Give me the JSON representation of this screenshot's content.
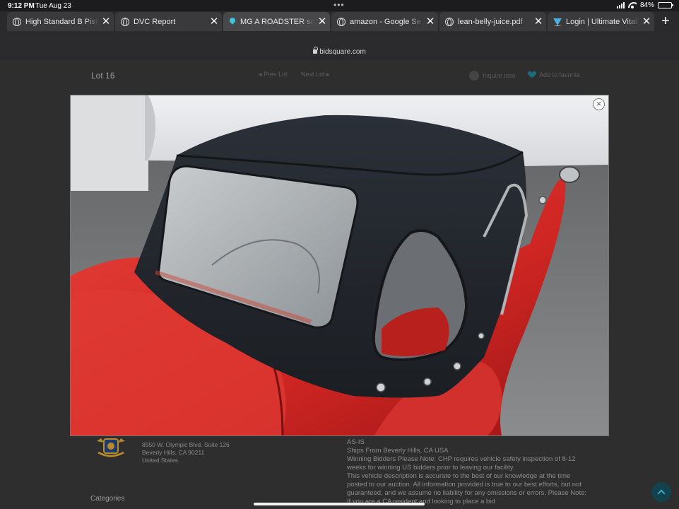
{
  "status_bar": {
    "time": "9:12 PM",
    "date": "Tue Aug 23",
    "dots": "•••",
    "battery": "84%",
    "battery_level": 0.84
  },
  "tabs": [
    {
      "title": "High Standard B Pistol",
      "icon": "globe-icon",
      "active": false
    },
    {
      "title": "DVC Report",
      "icon": "globe-icon",
      "active": false
    },
    {
      "title": "MG A ROADSTER sold",
      "icon": "pin-icon",
      "active": true
    },
    {
      "title": "amazon - Google Search",
      "icon": "globe-icon",
      "active": false
    },
    {
      "title": "lean-belly-juice.pdf",
      "icon": "globe-icon",
      "active": false
    },
    {
      "title": "Login | Ultimate Vitality",
      "icon": "bird-icon",
      "active": false
    }
  ],
  "tab_close": "✕",
  "new_tab": "+",
  "address": {
    "url": "bidsquare.com"
  },
  "page": {
    "lot": "Lot 16",
    "prev": "◂ Prev Lot",
    "next": "Next Lot ▸",
    "inquire": "Inquire now",
    "favorite": "Add to favorite",
    "seller_address": {
      "line1": "8950 W. Olympic Blvd. Suite 126",
      "line2": "Beverly Hills, CA 90211",
      "line3": "United States"
    },
    "description": {
      "line1": "AS-IS",
      "line2": "Ships From Beverly Hills, CA USA",
      "line3": "Winning Bidders Please Note: CHP requires vehicle safety inspection of 8-12 weeks for winning US bidders prior to leaving our facility.",
      "line4": "This vehicle description is accurate to the best of our knowledge at the time posted to our auction. All information provided is true to our best efforts, but not guaranteed, and we assume no liability for any omissions or errors. Please Note: If you are a CA resident and looking to place a bid"
    },
    "categories": "Categories"
  },
  "lightbox": {
    "close": "×",
    "image": "car-photo"
  },
  "colors": {
    "car_red": "#d42a28",
    "top_black": "#22262c",
    "accent": "#1e6b78"
  }
}
